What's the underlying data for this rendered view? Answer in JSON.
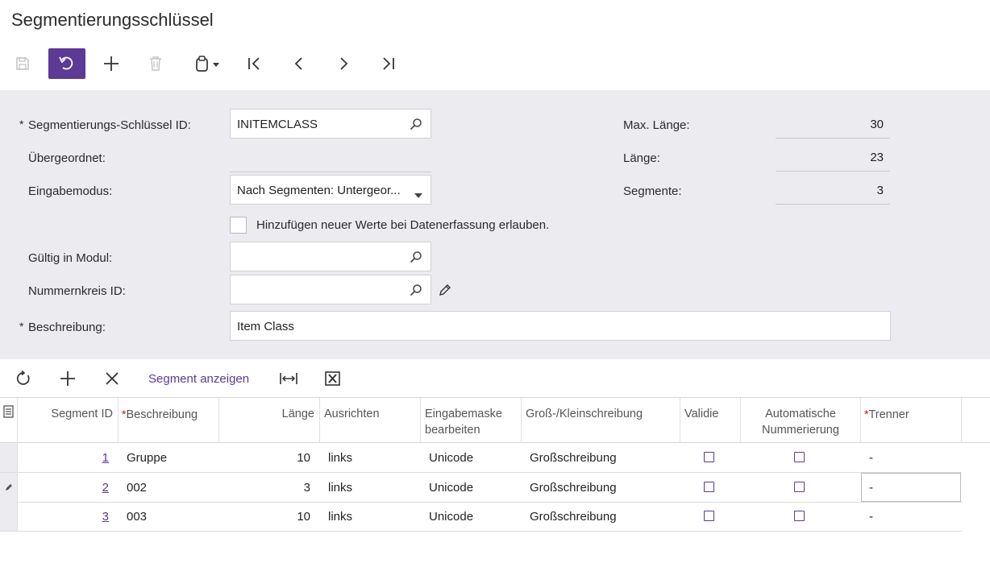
{
  "page": {
    "title": "Segmentierungsschlüssel"
  },
  "toolbar": {
    "buttons": [
      {
        "name": "save",
        "icon": "save-icon",
        "enabled": false
      },
      {
        "name": "undo",
        "icon": "undo-icon",
        "active": true
      },
      {
        "name": "add",
        "icon": "plus-icon"
      },
      {
        "name": "delete",
        "icon": "trash-icon",
        "enabled": false
      },
      {
        "name": "clipboard",
        "icon": "clipboard-icon"
      },
      {
        "name": "first",
        "icon": "first-record-icon"
      },
      {
        "name": "previous",
        "icon": "previous-record-icon"
      },
      {
        "name": "next",
        "icon": "next-record-icon"
      },
      {
        "name": "last",
        "icon": "last-record-icon"
      }
    ]
  },
  "form": {
    "segment_key_id": {
      "label": "Segmentierungs-Schlüssel ID:",
      "value": "INITEMCLASS",
      "required": "*"
    },
    "parent": {
      "label": "Übergeordnet:",
      "value": ""
    },
    "input_mode": {
      "label": "Eingabemodus:",
      "value": "Nach Segmenten: Untergeor..."
    },
    "allow_new_values": {
      "label": "Hinzufügen neuer Werte bei Datenerfassung erlauben.",
      "checked": false
    },
    "valid_in_module": {
      "label": "Gültig in Modul:",
      "value": ""
    },
    "numbering_id": {
      "label": "Nummernkreis ID:",
      "value": ""
    },
    "description": {
      "label": "Beschreibung:",
      "value": "Item Class",
      "required": "*"
    },
    "max_length": {
      "label": "Max. Länge:",
      "value": "30"
    },
    "length": {
      "label": "Länge:",
      "value": "23"
    },
    "segments": {
      "label": "Segmente:",
      "value": "3"
    }
  },
  "grid_toolbar": {
    "refresh_icon": "refresh-icon",
    "add_icon": "plus-icon",
    "delete_icon": "close-icon",
    "show_segment_label": "Segment anzeigen",
    "fit_columns_icon": "fit-columns-icon",
    "export_icon": "excel-export-icon"
  },
  "grid": {
    "columns": {
      "segment_id": "Segment ID",
      "description": "Beschreibung",
      "length": "Länge",
      "align": "Ausrichten",
      "edit_mask_1": "Eingabemaske",
      "edit_mask_2": "bearbeiten",
      "case": "Groß-/Kleinschreibung",
      "validate": "Validie",
      "auto_num_1": "Automatische",
      "auto_num_2": "Nummerierung",
      "separator": "Trenner",
      "required_mark": "*"
    },
    "rows": [
      {
        "segment_id": "1",
        "description": "Gruppe",
        "length": "10",
        "align": "links",
        "edit_mask": "Unicode",
        "case": "Großschreibung",
        "validate": false,
        "auto_numbering": false,
        "separator": "-"
      },
      {
        "segment_id": "2",
        "description": "002",
        "length": "3",
        "align": "links",
        "edit_mask": "Unicode",
        "case": "Großschreibung",
        "validate": false,
        "auto_numbering": false,
        "separator": "-"
      },
      {
        "segment_id": "3",
        "description": "003",
        "length": "10",
        "align": "links",
        "edit_mask": "Unicode",
        "case": "Großschreibung",
        "validate": false,
        "auto_numbering": false,
        "separator": "-"
      }
    ]
  },
  "colors": {
    "accent": "#5c3a95",
    "form_bg": "#ebebf0",
    "required": "#d0021b"
  }
}
